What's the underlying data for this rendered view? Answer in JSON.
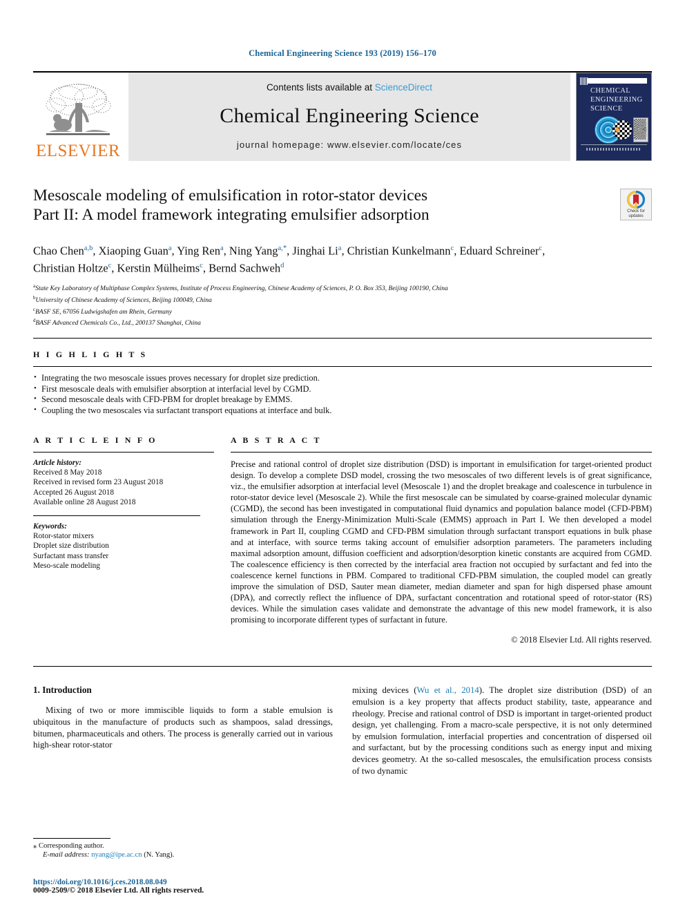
{
  "running_head": "Chemical Engineering Science 193 (2019) 156–170",
  "colors": {
    "link_blue": "#1a6496",
    "sciencedirect_blue": "#3a9bd1",
    "elsevier_orange": "#e87722",
    "cover_navy": "#1d2a5c"
  },
  "masthead": {
    "publisher_name": "ELSEVIER",
    "contents_prefix": "Contents lists available at ",
    "contents_link": "ScienceDirect",
    "journal_name": "Chemical Engineering Science",
    "homepage": "journal homepage: www.elsevier.com/locate/ces",
    "cover_title_lines": [
      "CHEMICAL",
      "ENGINEERING",
      "SCIENCE"
    ]
  },
  "title": {
    "line1": "Mesoscale modeling of emulsification in rotor-stator devices",
    "line2": "Part II: A model framework integrating emulsifier adsorption"
  },
  "crossmark": {
    "label_line1": "Check for",
    "label_line2": "updates"
  },
  "authors": [
    {
      "name": "Chao Chen",
      "sup": "a,b"
    },
    {
      "name": "Xiaoping Guan",
      "sup": "a"
    },
    {
      "name": "Ying Ren",
      "sup": "a"
    },
    {
      "name": "Ning Yang",
      "sup": "a,*"
    },
    {
      "name": "Jinghai Li",
      "sup": "a"
    },
    {
      "name": "Christian Kunkelmann",
      "sup": "c"
    },
    {
      "name": "Eduard Schreiner",
      "sup": "c"
    },
    {
      "name": "Christian Holtze",
      "sup": "c"
    },
    {
      "name": "Kerstin Mülheims",
      "sup": "c"
    },
    {
      "name": "Bernd Sachweh",
      "sup": "d"
    }
  ],
  "affiliations": [
    {
      "mark": "a",
      "text": "State Key Laboratory of Multiphase Complex Systems, Institute of Process Engineering, Chinese Academy of Sciences, P. O. Box 353, Beijing 100190, China"
    },
    {
      "mark": "b",
      "text": "University of Chinese Academy of Sciences, Beijing 100049, China"
    },
    {
      "mark": "c",
      "text": "BASF SE, 67056 Ludwigshafen am Rhein, Germany"
    },
    {
      "mark": "d",
      "text": "BASF Advanced Chemicals Co., Ltd., 200137 Shanghai, China"
    }
  ],
  "highlights": {
    "heading": "H I G H L I G H T S",
    "items": [
      "Integrating the two mesoscale issues proves necessary for droplet size prediction.",
      "First mesoscale deals with emulsifier absorption at interfacial level by CGMD.",
      "Second mesoscale deals with CFD-PBM for droplet breakage by EMMS.",
      "Coupling the two mesoscales via surfactant transport equations at interface and bulk."
    ]
  },
  "article_info": {
    "heading": "A R T I C L E    I N F O",
    "history_label": "Article history:",
    "history": [
      "Received 8 May 2018",
      "Received in revised form 23 August 2018",
      "Accepted 26 August 2018",
      "Available online 28 August 2018"
    ],
    "keywords_label": "Keywords:",
    "keywords": [
      "Rotor-stator mixers",
      "Droplet size distribution",
      "Surfactant mass transfer",
      "Meso-scale modeling"
    ]
  },
  "abstract": {
    "heading": "A B S T R A C T",
    "text": "Precise and rational control of droplet size distribution (DSD) is important in emulsification for target-oriented product design. To develop a complete DSD model, crossing the two mesoscales of two different levels is of great significance, viz., the emulsifier adsorption at interfacial level (Mesoscale 1) and the droplet breakage and coalescence in turbulence in rotor-stator device level (Mesoscale 2). While the first mesoscale can be simulated by coarse-grained molecular dynamic (CGMD), the second has been investigated in computational fluid dynamics and population balance model (CFD-PBM) simulation through the Energy-Minimization Multi-Scale (EMMS) approach in Part I. We then developed a model framework in Part II, coupling CGMD and CFD-PBM simulation through surfactant transport equations in bulk phase and at interface, with source terms taking account of emulsifier adsorption parameters. The parameters including maximal adsorption amount, diffusion coefficient and adsorption/desorption kinetic constants are acquired from CGMD. The coalescence efficiency is then corrected by the interfacial area fraction not occupied by surfactant and fed into the coalescence kernel functions in PBM. Compared to traditional CFD-PBM simulation, the coupled model can greatly improve the simulation of DSD, Sauter mean diameter, median diameter and span for high dispersed phase amount (DPA), and correctly reflect the influence of DPA, surfactant concentration and rotational speed of rotor-stator (RS) devices. While the simulation cases validate and demonstrate the advantage of this new model framework, it is also promising to incorporate different types of surfactant in future.",
    "copyright": "© 2018 Elsevier Ltd. All rights reserved."
  },
  "body": {
    "section_heading": "1. Introduction",
    "left_paragraph": "Mixing of two or more immiscible liquids to form a stable emulsion is ubiquitous in the manufacture of products such as shampoos, salad dressings, bitumen, pharmaceuticals and others. The process is generally carried out in various high-shear rotor-stator",
    "right_paragraph_pre": "mixing devices (",
    "right_paragraph_cite": "Wu et al., 2014",
    "right_paragraph_post": "). The droplet size distribution (DSD) of an emulsion is a key property that affects product stability, taste, appearance and rheology. Precise and rational control of DSD is important in target-oriented product design, yet challenging. From a macro-scale perspective, it is not only determined by emulsion formulation, interfacial properties and concentration of dispersed oil and surfactant, but by the processing conditions such as energy input and mixing devices geometry. At the so-called mesoscales, the emulsification process consists of two dynamic"
  },
  "footnote": {
    "corresponding_marker": "⁎",
    "corresponding_text": "Corresponding author.",
    "email_label": "E-mail address:",
    "email": "nyang@ipe.ac.cn",
    "email_owner": "(N. Yang).",
    "doi": "https://doi.org/10.1016/j.ces.2018.08.049",
    "issn_line": "0009-2509/© 2018 Elsevier Ltd. All rights reserved."
  }
}
